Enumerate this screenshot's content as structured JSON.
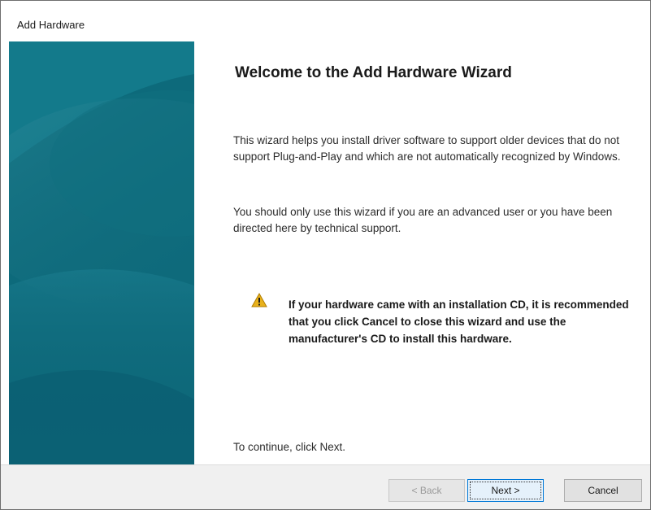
{
  "window": {
    "title": "Add Hardware"
  },
  "side_art": {
    "colors": [
      "#0f6e7f",
      "#0a5a6e",
      "#2a8a9a"
    ]
  },
  "content": {
    "heading": "Welcome to the Add Hardware Wizard",
    "paragraph1": "This wizard helps you install driver software to support older devices that do not support Plug-and-Play and which are not automatically recognized by Windows.",
    "paragraph2": "You should only use this wizard if you are an advanced user or you have been directed here by technical support.",
    "warning": {
      "icon": "warning-icon",
      "text": "If your hardware came with an installation CD, it is recommended that you click Cancel to close this wizard and use the manufacturer's CD to install this hardware."
    },
    "continue_text": "To continue, click Next."
  },
  "footer": {
    "back_label": "< Back",
    "next_label": "Next >",
    "cancel_label": "Cancel"
  }
}
